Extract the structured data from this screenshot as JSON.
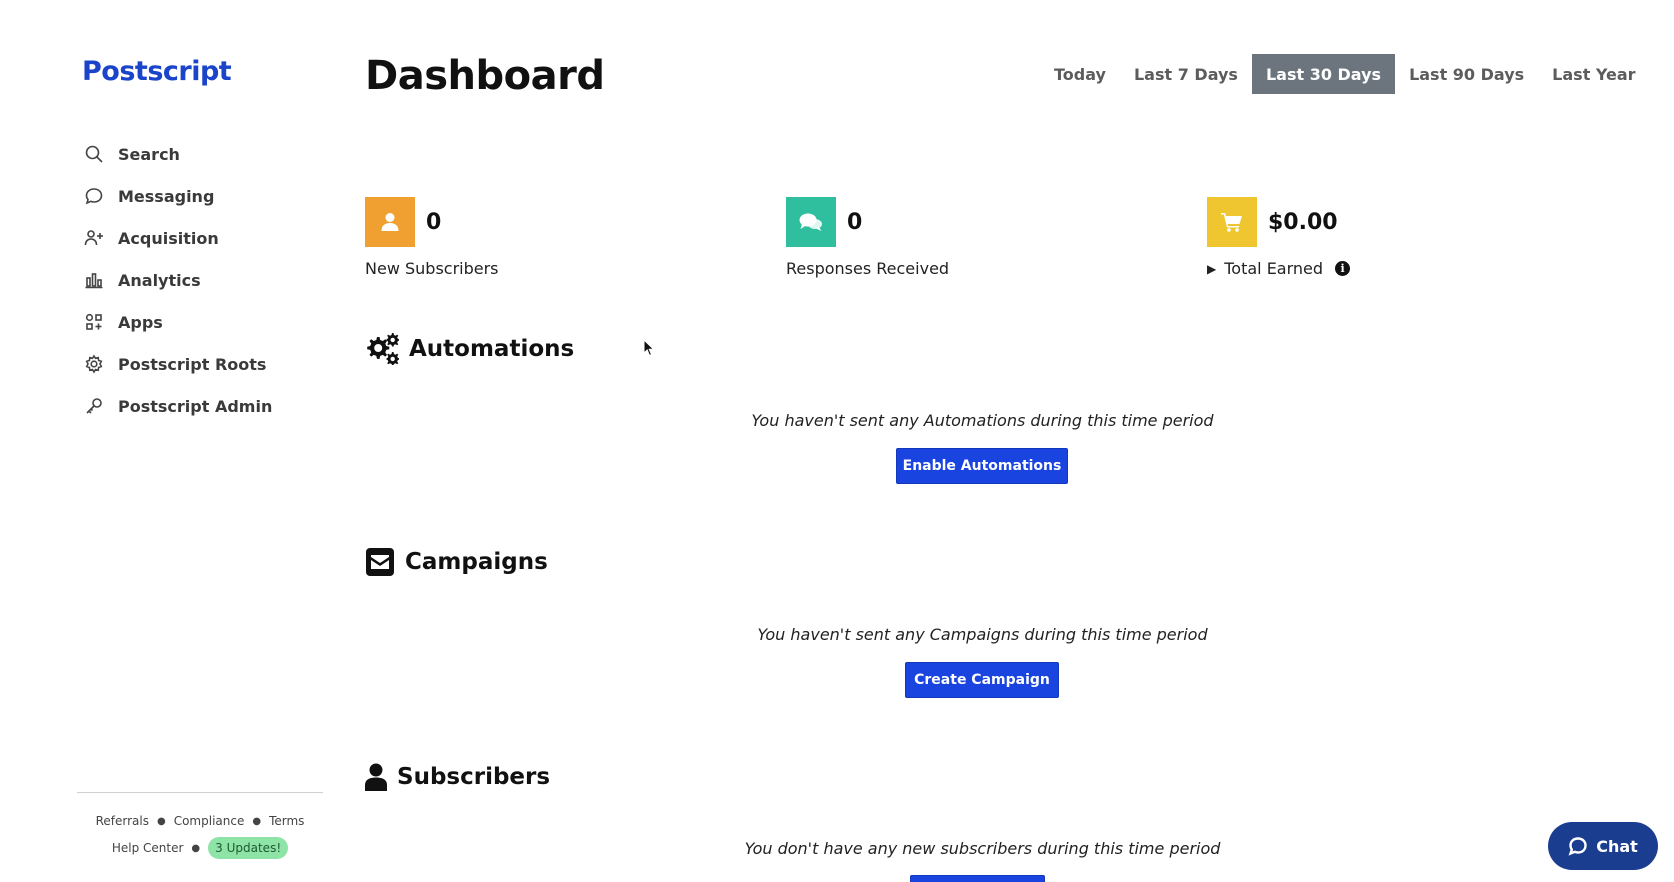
{
  "app": {
    "logo": "Postscript"
  },
  "sidebar": {
    "items": [
      {
        "label": "Search",
        "icon": "search-icon"
      },
      {
        "label": "Messaging",
        "icon": "message-bubble-icon"
      },
      {
        "label": "Acquisition",
        "icon": "user-plus-icon"
      },
      {
        "label": "Analytics",
        "icon": "bar-chart-icon"
      },
      {
        "label": "Apps",
        "icon": "apps-grid-icon"
      },
      {
        "label": "Postscript Roots",
        "icon": "gear-icon"
      },
      {
        "label": "Postscript Admin",
        "icon": "key-icon"
      }
    ],
    "footer": {
      "referrals": "Referrals",
      "compliance": "Compliance",
      "terms": "Terms",
      "help_center": "Help Center",
      "updates_badge": "3 Updates!"
    }
  },
  "header": {
    "title": "Dashboard",
    "ranges": [
      "Today",
      "Last 7 Days",
      "Last 30 Days",
      "Last 90 Days",
      "Last Year"
    ],
    "active_range": "Last 30 Days"
  },
  "stats": [
    {
      "value": "0",
      "label": "New Subscribers",
      "icon": "user-icon",
      "color": "#f0a030"
    },
    {
      "value": "0",
      "label": "Responses Received",
      "icon": "chat-bubbles-icon",
      "color": "#2fbf9f"
    },
    {
      "value": "$0.00",
      "label": "Total Earned",
      "icon": "cart-icon",
      "color": "#f0c630"
    }
  ],
  "sections": {
    "automations": {
      "title": "Automations",
      "empty_message": "You haven't sent any Automations during this time period",
      "button": "Enable Automations"
    },
    "campaigns": {
      "title": "Campaigns",
      "empty_message": "You haven't sent any Campaigns during this time period",
      "button": "Create Campaign"
    },
    "subscribers": {
      "title": "Subscribers",
      "empty_message": "You don't have any new subscribers during this time period"
    }
  },
  "chat": {
    "label": "Chat"
  },
  "colors": {
    "brand": "#1a44c9",
    "primary_button": "#1a44e0",
    "active_tab": "#6c757d",
    "chat": "#1a3d8f"
  }
}
